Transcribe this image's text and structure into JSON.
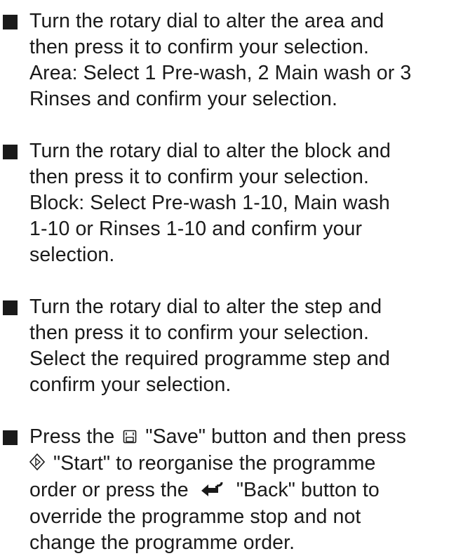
{
  "steps": [
    {
      "lines": [
        "Turn the rotary dial to alter the area and",
        "then press it to confirm your selection.",
        "Area: Select 1 Pre-wash, 2 Main wash or 3",
        "Rinses and confirm your selection."
      ]
    },
    {
      "lines": [
        "Turn the rotary dial to alter the block and",
        "then press it to confirm your selection.",
        "Block: Select Pre-wash 1-10, Main wash",
        "1-10 or Rinses 1-10 and confirm your",
        "selection."
      ]
    },
    {
      "lines": [
        "Turn the rotary dial to alter the step and",
        "then press it to confirm your selection.",
        "Select the required programme step and",
        "confirm your selection."
      ]
    },
    {
      "line1_before": "Press the",
      "line1_after": "\"Save\" button and then press",
      "line2_after": "\"Start\" to reorganise the programme",
      "line3_before": "order or press the",
      "line3_after": "\"Back\" button to",
      "line4": "override the programme stop and not",
      "line5": "change the programme order.",
      "icons": {
        "save": "save-icon",
        "start": "start-icon",
        "back": "back-arrow-icon"
      }
    }
  ]
}
